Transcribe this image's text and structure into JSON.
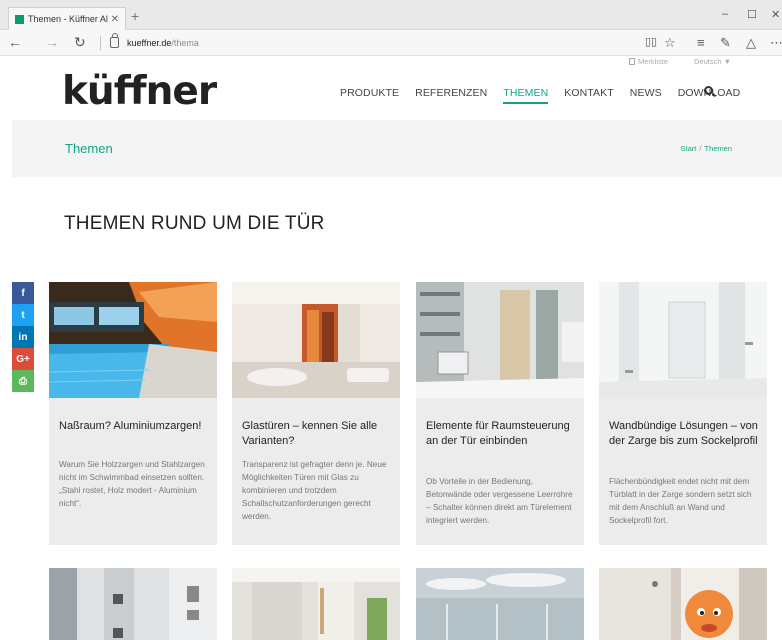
{
  "browser": {
    "tab_title": "Themen - Küffner Aluza",
    "url_domain": "kueffner.de",
    "url_path": "/thema",
    "icons": [
      "back-icon",
      "forward-icon",
      "refresh-icon",
      "lock-icon",
      "reading-view-icon",
      "favorite-star-icon",
      "hub-icon",
      "web-note-icon",
      "share-icon",
      "more-icon"
    ]
  },
  "utility": {
    "merkliste": "Merkliste",
    "language": "Deutsch ▼"
  },
  "header": {
    "logo": "küffner",
    "nav": [
      "PRODUKTE",
      "REFERENZEN",
      "THEMEN",
      "KONTAKT",
      "NEWS",
      "DOWNLOAD"
    ],
    "active_nav": "THEMEN"
  },
  "titleband": {
    "title": "Themen",
    "breadcrumb_start": "Start",
    "breadcrumb_sep": "/",
    "breadcrumb_current": "Themen"
  },
  "heading": "THEMEN RUND UM DIE TÜR",
  "social": [
    {
      "label": "f",
      "color": "#3b5998"
    },
    {
      "label": "t",
      "color": "#1da1f2"
    },
    {
      "label": "in",
      "color": "#0077b5"
    },
    {
      "label": "G+",
      "color": "#dd4b39"
    },
    {
      "label": "⎙",
      "color": "#5cb85c"
    }
  ],
  "cards": [
    {
      "title": "Naßraum? Aluminiumzargen!",
      "text": "Warum Sie Holzzargen und Stahlzargen nicht im Schwimmbad einsetzen sollten. „Stahl rostet, Holz modert - Aluminium nicht“."
    },
    {
      "title": "Glastüren – kennen Sie alle Varianten?",
      "text": "Transparenz ist gefragter denn je. Neue Möglichkeiten Türen mit Glas zu kombinieren und trotzdem Schallschutzanforderungen gerecht werden."
    },
    {
      "title": "Elemente für Raumsteuerung an der Tür einbinden",
      "text": "Ob Vorteile in der Bedienung, Betonwände oder vergessene Leerrohre – Schalter können direkt am Türelement integriert werden."
    },
    {
      "title": "Wandbündige Lösungen – von der Zarge bis zum Sockelprofil",
      "text": "Flächenbündigkeit endet nicht mit dem Türblatt in der Zarge sondern setzt sich mit dem Anschluß an Wand und Sockelprofil fort."
    }
  ],
  "colors": {
    "accent": "#16a383",
    "band_bg": "#f4f4f4",
    "card_bg": "#ececec"
  }
}
